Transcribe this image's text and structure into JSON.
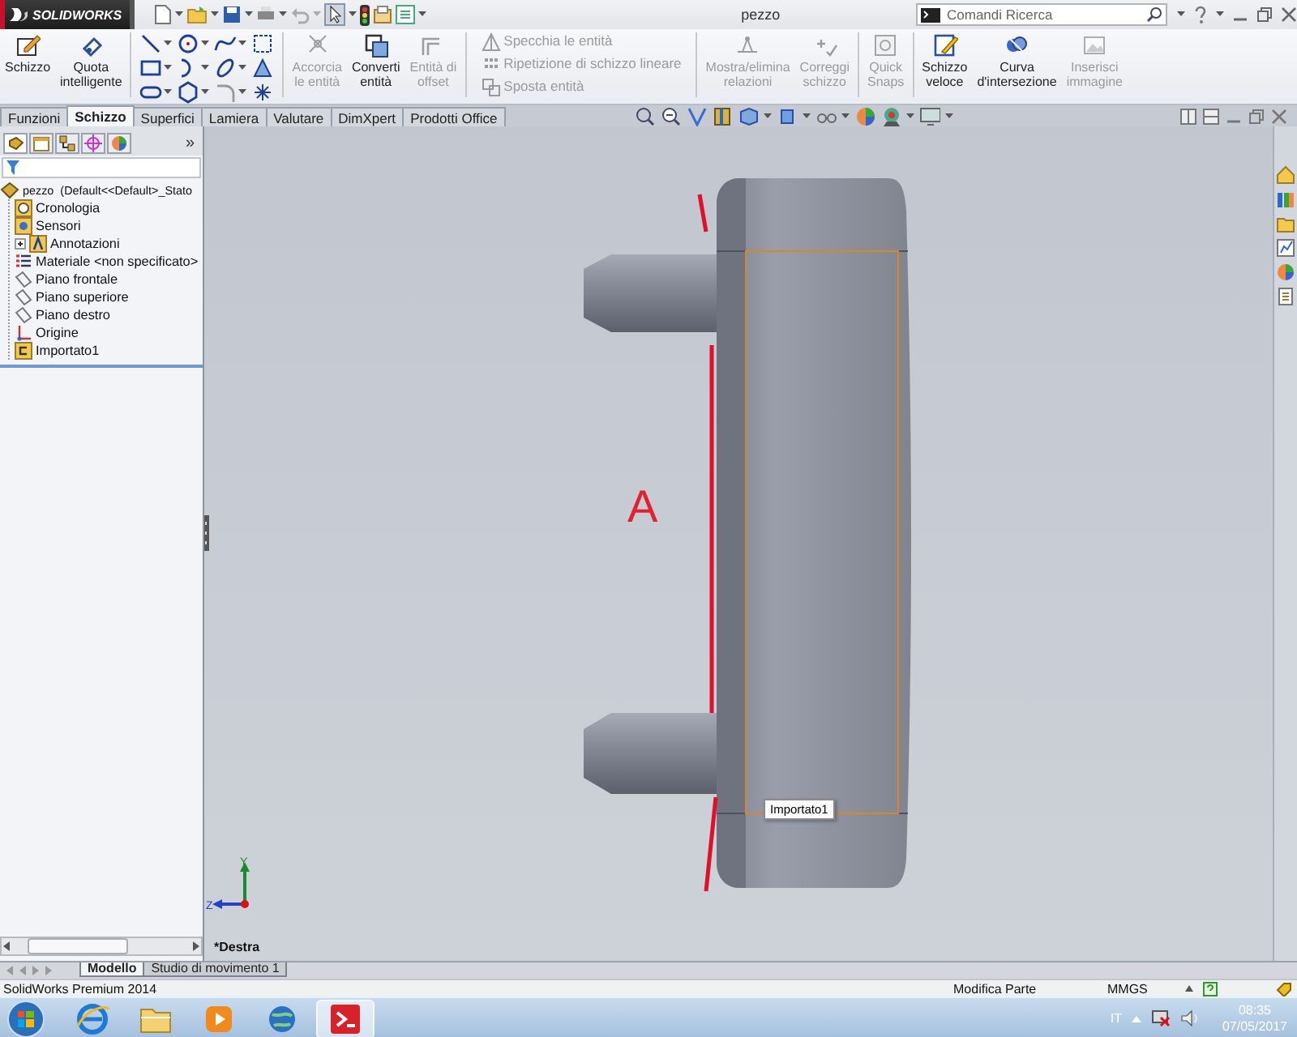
{
  "title_bar": {
    "logo": "SOLIDWORKS",
    "document_title": "pezzo",
    "search": {
      "placeholder": "Comandi Ricerca"
    }
  },
  "ribbon": {
    "sections": [
      {
        "kind": "large",
        "items": [
          {
            "label": "Schizzo",
            "disabled": false
          },
          {
            "label": "Quota\nintelligente",
            "disabled": false
          }
        ]
      },
      {
        "kind": "tools"
      },
      {
        "kind": "large",
        "items": [
          {
            "label": "Accorcia\nle entità",
            "disabled": true
          },
          {
            "label": "Converti\nentità",
            "disabled": false
          },
          {
            "label": "Entità di\noffset",
            "disabled": true
          }
        ]
      },
      {
        "kind": "list",
        "items": [
          {
            "label": "Specchia le entità",
            "disabled": true
          },
          {
            "label": "Ripetizione di schizzo lineare",
            "disabled": true
          },
          {
            "label": "Sposta entità",
            "disabled": true
          }
        ]
      },
      {
        "kind": "large",
        "items": [
          {
            "label": "Mostra/elimina\nrelazioni",
            "disabled": true
          },
          {
            "label": "Correggi\nschizzo",
            "disabled": true
          }
        ]
      },
      {
        "kind": "large",
        "items": [
          {
            "label": "Quick\nSnaps",
            "disabled": true
          }
        ]
      },
      {
        "kind": "large",
        "items": [
          {
            "label": "Schizzo\nveloce",
            "disabled": false
          },
          {
            "label": "Curva\nd'intersezione",
            "disabled": false
          },
          {
            "label": "Inserisci\nimmagine",
            "disabled": true
          }
        ]
      }
    ]
  },
  "command_tabs": [
    {
      "label": "Funzioni",
      "selected": false
    },
    {
      "label": "Schizzo",
      "selected": true
    },
    {
      "label": "Superfici",
      "selected": false
    },
    {
      "label": "Lamiera",
      "selected": false
    },
    {
      "label": "Valutare",
      "selected": false
    },
    {
      "label": "DimXpert",
      "selected": false
    },
    {
      "label": "Prodotti Office",
      "selected": false
    }
  ],
  "feature_tree": {
    "more": "»",
    "root": {
      "label": "pezzo  (Default<<Default>_Stato",
      "children": [
        {
          "label": "Cronologia",
          "kind": "history",
          "collapsed": false
        },
        {
          "label": "Sensori",
          "kind": "sensors",
          "collapsed": false
        },
        {
          "label": "Annotazioni",
          "kind": "annotations",
          "collapsed": true
        },
        {
          "label": "Materiale <non specificato>",
          "kind": "material",
          "collapsed": false
        },
        {
          "label": "Piano frontale",
          "kind": "plane",
          "collapsed": false
        },
        {
          "label": "Piano superiore",
          "kind": "plane",
          "collapsed": false
        },
        {
          "label": "Piano destro",
          "kind": "plane",
          "collapsed": false
        },
        {
          "label": "Origine",
          "kind": "origin",
          "collapsed": false
        },
        {
          "label": "Importato1",
          "kind": "feature",
          "collapsed": false
        }
      ]
    }
  },
  "viewport": {
    "annotation": "A",
    "tooltip": "Importato1",
    "axes": {
      "y": "Y",
      "z": "Z"
    },
    "view_name": "*Destra"
  },
  "model_tabs": [
    {
      "label": "Modello",
      "selected": true
    },
    {
      "label": "Studio di movimento 1",
      "selected": false
    }
  ],
  "status_bar": {
    "product": "SolidWorks Premium 2014",
    "mode": "Modifica Parte",
    "units": "MMGS"
  },
  "taskbar": {
    "apps": [
      {
        "kind": "browser",
        "selected": false
      },
      {
        "kind": "folder",
        "selected": false
      },
      {
        "kind": "media",
        "selected": false
      },
      {
        "kind": "globe",
        "selected": false
      },
      {
        "kind": "cad",
        "selected": true
      }
    ],
    "language": "IT",
    "time": "08:35",
    "date": "07/05/2017"
  }
}
